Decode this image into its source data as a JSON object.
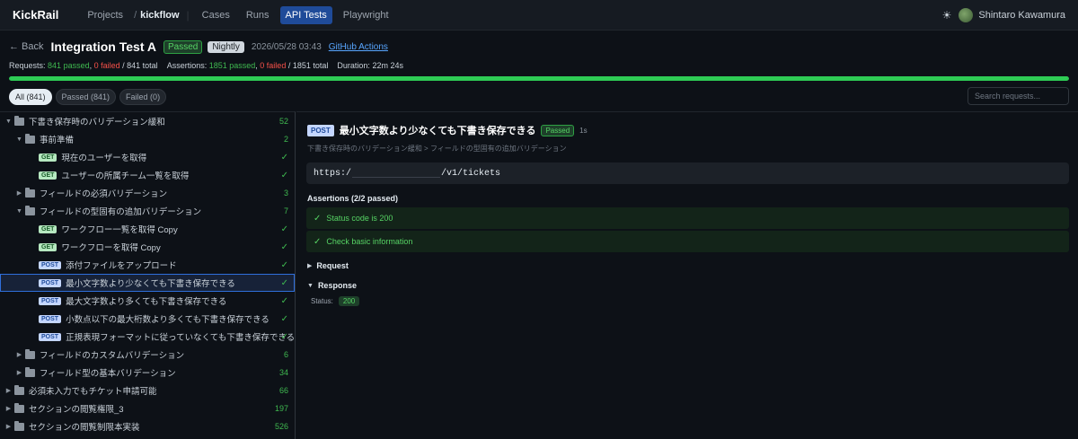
{
  "nav": {
    "brand": "KickRail",
    "projects": "Projects",
    "separator": "/",
    "project": "kickflow",
    "divider": "|",
    "items": [
      "Cases",
      "Runs",
      "API Tests",
      "Playwright"
    ],
    "active_index": 2,
    "user_name": "Shintaro Kawamura"
  },
  "header": {
    "back": "← Back",
    "title": "Integration Test A",
    "status_badge": "Passed",
    "trigger_badge": "Nightly",
    "date": "2026/05/28 03:43",
    "source_link": "GitHub Actions",
    "stats": {
      "requests_label": "Requests:",
      "requests_passed": "841 passed",
      "requests_failed": "0 failed",
      "requests_total": "/ 841 total",
      "assertions_label": "Assertions:",
      "assertions_passed": "1851 passed",
      "assertions_failed": "0 failed",
      "assertions_total": "/ 1851 total",
      "duration_label": "Duration:",
      "duration": "22m 24s"
    },
    "progress_percent": 100
  },
  "filters": {
    "chips": [
      "All (841)",
      "Passed (841)",
      "Failed (0)"
    ],
    "active_index": 0,
    "search_placeholder": "Search requests..."
  },
  "tree": [
    {
      "kind": "folder",
      "depth": 0,
      "open": true,
      "label": "下書き保存時のバリデーション緩和",
      "count": "52"
    },
    {
      "kind": "folder",
      "depth": 1,
      "open": true,
      "label": "事前準備",
      "count": "2"
    },
    {
      "kind": "request",
      "depth": 2,
      "method": "GET",
      "label": "現在のユーザーを取得",
      "passed": true
    },
    {
      "kind": "request",
      "depth": 2,
      "method": "GET",
      "label": "ユーザーの所属チーム一覧を取得",
      "passed": true
    },
    {
      "kind": "folder",
      "depth": 1,
      "open": false,
      "label": "フィールドの必須バリデーション",
      "count": "3"
    },
    {
      "kind": "folder",
      "depth": 1,
      "open": true,
      "label": "フィールドの型固有の追加バリデーション",
      "count": "7"
    },
    {
      "kind": "request",
      "depth": 2,
      "method": "GET",
      "label": "ワークフロー一覧を取得 Copy",
      "passed": true
    },
    {
      "kind": "request",
      "depth": 2,
      "method": "GET",
      "label": "ワークフローを取得 Copy",
      "passed": true
    },
    {
      "kind": "request",
      "depth": 2,
      "method": "POST",
      "label": "添付ファイルをアップロード",
      "passed": true
    },
    {
      "kind": "request",
      "depth": 2,
      "method": "POST",
      "label": "最小文字数より少なくても下書き保存できる",
      "passed": true,
      "selected": true
    },
    {
      "kind": "request",
      "depth": 2,
      "method": "POST",
      "label": "最大文字数より多くても下書き保存できる",
      "passed": true
    },
    {
      "kind": "request",
      "depth": 2,
      "method": "POST",
      "label": "小数点以下の最大桁数より多くても下書き保存できる",
      "passed": true
    },
    {
      "kind": "request",
      "depth": 2,
      "method": "POST",
      "label": "正規表現フォーマットに従っていなくても下書き保存できる",
      "passed": true
    },
    {
      "kind": "folder",
      "depth": 1,
      "open": false,
      "label": "フィールドのカスタムバリデーション",
      "count": "6"
    },
    {
      "kind": "folder",
      "depth": 1,
      "open": false,
      "label": "フィールド型の基本バリデーション",
      "count": "34"
    },
    {
      "kind": "folder",
      "depth": 0,
      "open": false,
      "label": "必須未入力でもチケット申請可能",
      "count": "66"
    },
    {
      "kind": "folder",
      "depth": 0,
      "open": false,
      "label": "セクションの閲覧権限_3",
      "count": "197"
    },
    {
      "kind": "folder",
      "depth": 0,
      "open": false,
      "label": "セクションの閲覧制限本実装",
      "count": "526"
    }
  ],
  "tree_glyphs": {
    "open": "▼",
    "closed": "▶",
    "check": "✓"
  },
  "detail": {
    "method": "POST",
    "title": "最小文字数より少なくても下書き保存できる",
    "status_badge": "Passed",
    "time": "1s",
    "breadcrumb": "下書き保存時のバリデーション緩和 > フィールドの型固有の追加バリデーション",
    "url_prefix": "https:/",
    "url_suffix": "/v1/tickets",
    "assertions_title": "Assertions (2/2 passed)",
    "assertions": [
      "Status code is 200",
      "Check basic information"
    ],
    "request_label": "Request",
    "response_label": "Response",
    "status_label": "Status:",
    "status_value": "200"
  },
  "icons": {
    "theme": "sun-icon",
    "check": "check-icon",
    "folder": "folder-icon"
  },
  "colors": {
    "accent": "#1f4b99",
    "success": "#3fb950",
    "failure": "#f85149",
    "background": "#0d1117"
  }
}
